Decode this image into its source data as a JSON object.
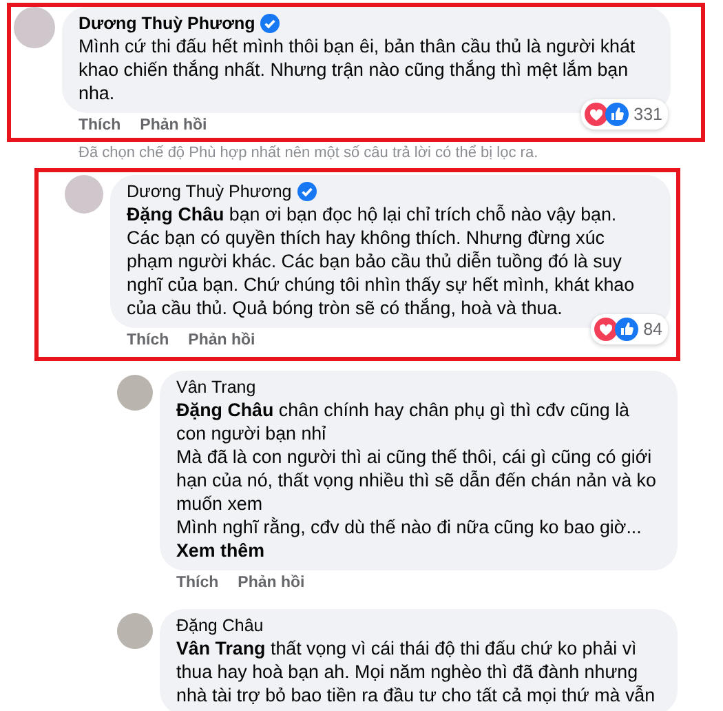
{
  "comments": [
    {
      "author": "Dương Thuỳ Phương",
      "verified": true,
      "highlighted": true,
      "paragraphs": [
        "Mình cứ thi đấu hết mình thôi bạn êi, bản thân cầu thủ là người khát khao chiến thắng nhất. Nhưng trận nào cũng thắng thì mệt lắm bạn nha."
      ],
      "reaction_count": "331",
      "actions": [
        "Thích",
        "Phản hồi"
      ],
      "note": "Đã chọn chế độ Phù hợp nhất nên một số câu trả lời có thể bị lọc ra.",
      "children": [
        {
          "author": "Dương Thuỳ Phương",
          "verified": true,
          "highlighted": true,
          "paragraphs": [
            "**Đặng Châu** bạn ơi bạn đọc hộ lại chỉ trích chỗ nào vậy bạn. Các bạn có quyền thích hay không thích. Nhưng đừng xúc phạm người khác. Các bạn bảo cầu thủ diễn tuồng đó là suy nghĩ của bạn. Chứ chúng tôi nhìn thấy sự hết mình, khát khao của cầu thủ. Quả bóng tròn sẽ có thắng, hoà và thua."
          ],
          "reaction_count": "84",
          "actions": [
            "Thích",
            "Phản hồi"
          ],
          "children": [
            {
              "author": "Vân Trang",
              "verified": false,
              "highlighted": false,
              "paragraphs": [
                "**Đặng Châu** chân chính hay chân phụ gì thì cđv cũng là con người bạn nhỉ",
                "Mà đã là con người thì ai cũng thế thôi, cái gì cũng có giới hạn của nó, thất vọng nhiều thì sẽ dẫn đến chán nản và ko muốn xem",
                "Mình nghĩ rằng, cđv dù thế nào đi nữa cũng ko bao giờ..."
              ],
              "see_more": "Xem thêm",
              "actions": [
                "Thích",
                "Phản hồi"
              ]
            },
            {
              "author": "Đặng Châu",
              "verified": false,
              "highlighted": false,
              "paragraphs": [
                "**Vân Trang** thất vọng vì cái thái độ thi đấu chứ ko phải vì thua hay hoà bạn ah. Mọi năm nghèo thì đã đành nhưng nhà tài trợ bỏ bao tiền ra đầu tư cho tất cả mọi thứ mà vẫn"
              ]
            }
          ]
        }
      ]
    }
  ]
}
